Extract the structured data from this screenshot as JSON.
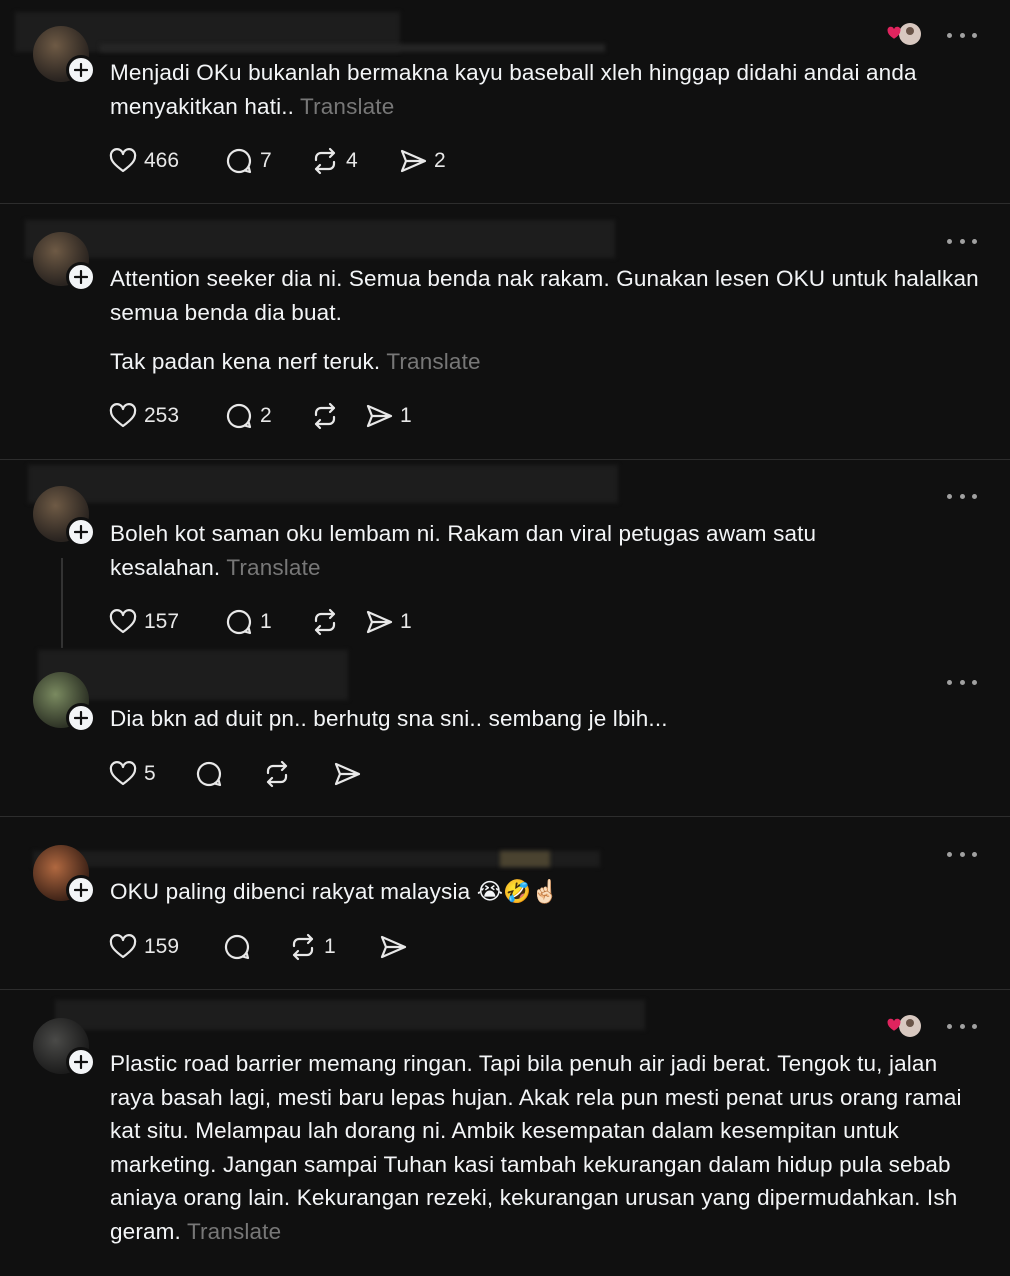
{
  "translate_label": "Translate",
  "posts": [
    {
      "paragraphs": [
        "Menjadi OKu bukanlah bermakna kayu baseball xleh hinggap didahi andai anda menyakitkan hati.."
      ],
      "likes": "466",
      "replies": "7",
      "reposts": "4",
      "shares": "2"
    },
    {
      "paragraphs": [
        "Attention seeker dia ni. Semua benda nak rakam. Gunakan lesen OKU untuk halalkan semua benda dia buat.",
        "Tak padan kena nerf teruk."
      ],
      "likes": "253",
      "replies": "2",
      "reposts": "",
      "shares": "1"
    },
    {
      "paragraphs": [
        "Boleh kot saman oku lembam ni. Rakam dan viral petugas awam satu kesalahan."
      ],
      "likes": "157",
      "replies": "1",
      "reposts": "",
      "shares": "1"
    },
    {
      "paragraphs": [
        "Dia bkn ad duit pn.. berhutg sna sni.. sembang je lbih..."
      ],
      "likes": "5",
      "replies": "",
      "reposts": "",
      "shares": ""
    },
    {
      "paragraphs": [
        "OKU paling dibenci rakyat malaysia 😭🤣☝🏻"
      ],
      "likes": "159",
      "replies": "",
      "reposts": "1",
      "shares": ""
    },
    {
      "paragraphs": [
        "Plastic road barrier memang ringan. Tapi bila penuh air jadi berat. Tengok tu, jalan raya basah lagi, mesti baru lepas hujan. Akak rela pun mesti penat urus orang ramai kat situ. Melampau lah dorang ni. Ambik kesempatan dalam kesempitan untuk marketing. Jangan sampai Tuhan kasi tambah kekurangan dalam hidup pula sebab aniaya orang lain. Kekurangan rezeki, kekurangan urusan yang dipermudahkan. Ish geram."
      ],
      "likes": "",
      "replies": "",
      "reposts": "",
      "shares": ""
    }
  ],
  "colors": {
    "background": "#101010",
    "text": "#f3f5f7",
    "muted": "#777777",
    "heart_red": "#e0245e"
  }
}
